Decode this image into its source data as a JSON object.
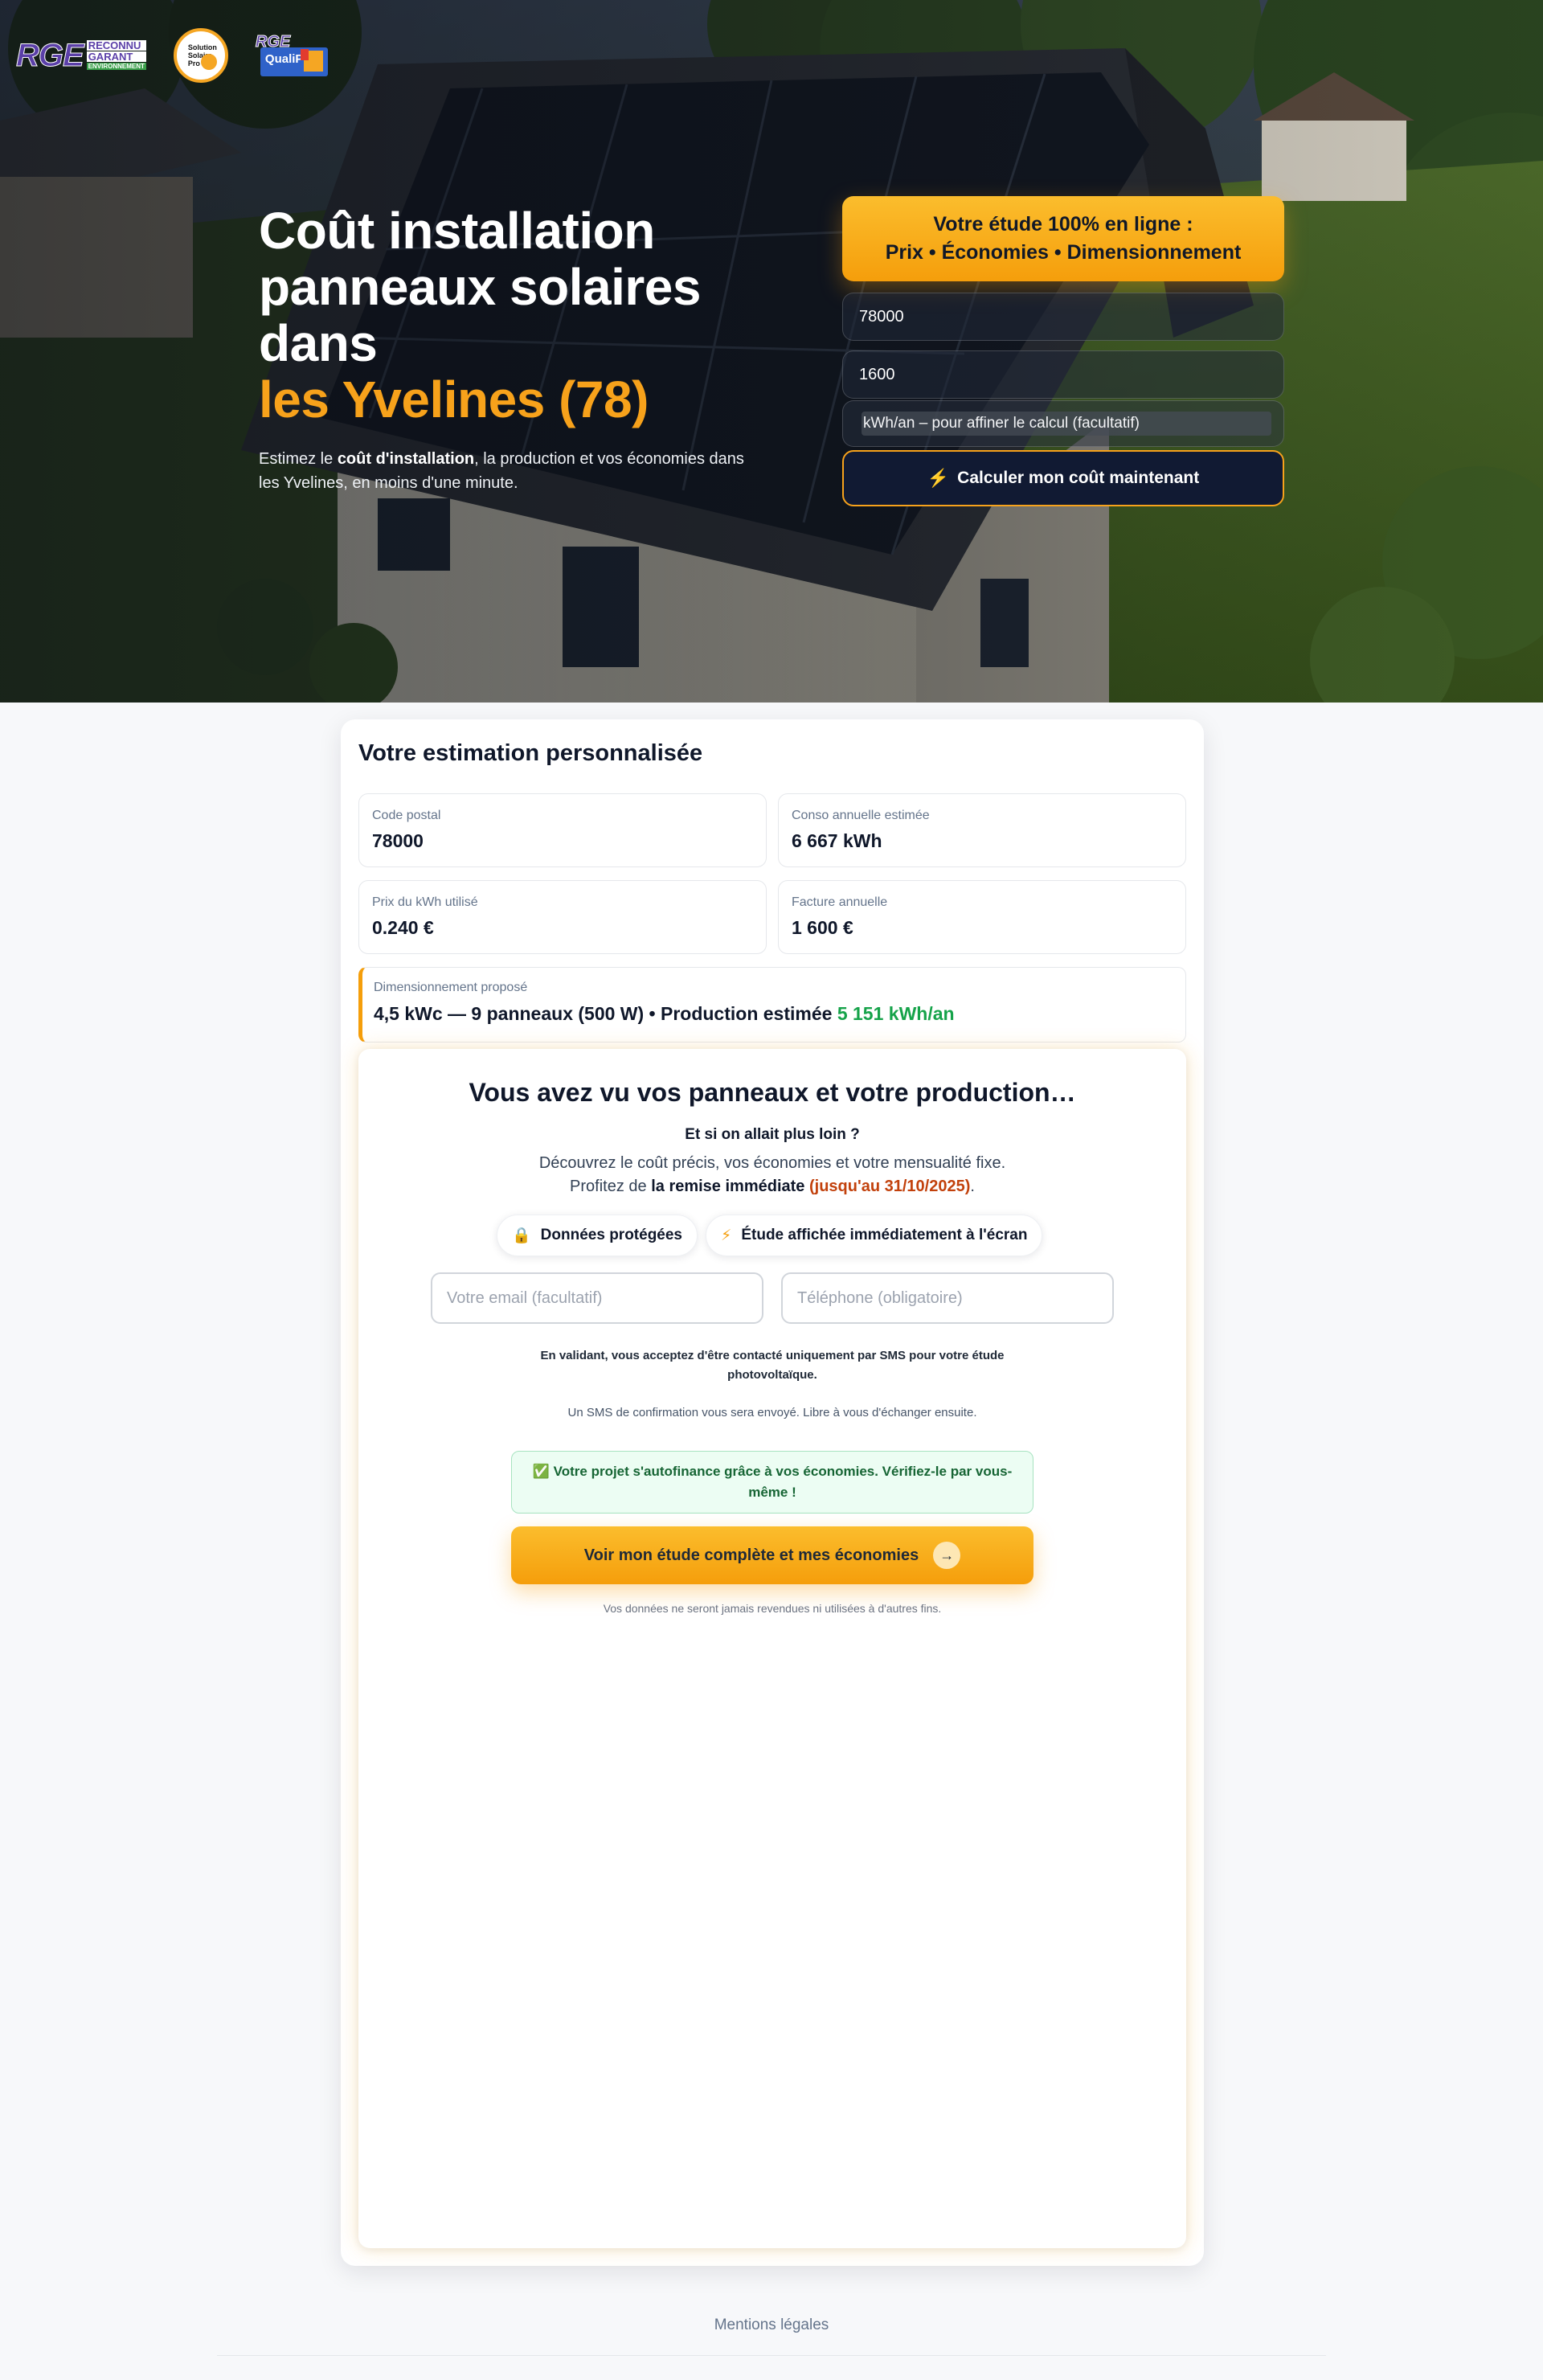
{
  "hero": {
    "title_line1": "Coût installation",
    "title_line2": "panneaux solaires",
    "title_line3": "dans",
    "title_accent": "les Yvelines (78)",
    "subtitle_pre": "Estimez le ",
    "subtitle_bold": "coût d'installation",
    "subtitle_post": ", la production et vos économies dans les Yvelines, en moins d'une minute.",
    "background_image": "house-with-solar-roof-photo"
  },
  "logos": {
    "rge_big": "RGE",
    "rge_line1": "RECONNU",
    "rge_line2": "GARANT",
    "rge_line3": "ENVIRONNEMENT",
    "seal_line1": "Solution",
    "seal_line2": "Solaire",
    "seal_line3": "Pro",
    "qpv_rge": "RGE",
    "qpv_text": "QualiPV"
  },
  "form": {
    "panel_line1": "Votre étude 100% en ligne :",
    "panel_line2": "Prix • Économies • Dimensionnement",
    "postal_value": "78000",
    "bill_value": "1600",
    "kwh_hint": "kWh/an – pour affiner le calcul (facultatif)",
    "submit_icon": "⚡",
    "submit_label": "Calculer mon coût maintenant"
  },
  "estimate": {
    "title": "Votre estimation personnalisée",
    "postal_label": "Code postal",
    "postal_value": "78000",
    "conso_label": "Conso annuelle estimée",
    "conso_value": "6 667 kWh",
    "price_label": "Prix du kWh utilisé",
    "price_value": "0.240 €",
    "bill_label": "Facture annuelle",
    "bill_value": "1 600 €",
    "dim_label": "Dimensionnement proposé",
    "dim_value": "4,5 kWc — 9 panneaux (500 W) • Production estimée ",
    "dim_production": "5 151 kWh/an"
  },
  "lead": {
    "heading": "Vous avez vu vos panneaux et votre production…",
    "question": "Et si on allait plus loin ?",
    "para1": "Découvrez le coût précis, vos économies et votre mensualité fixe.",
    "para2_pre": "Profitez de ",
    "para2_bold": "la remise immédiate",
    "para2_deadline": "(jusqu'au 31/10/2025)",
    "para2_end": ".",
    "chip1_icon": "🔒",
    "chip1_label": "Données protégées",
    "chip2_icon": "⚡",
    "chip2_label": "Étude affichée immédiatement à l'écran",
    "email_placeholder": "Votre email (facultatif)",
    "phone_placeholder": "Téléphone (obligatoire)",
    "consent": "En validant, vous acceptez d'être contacté uniquement par SMS pour votre étude photovoltaïque.",
    "sms_note": "Un SMS de confirmation vous sera envoyé. Libre à vous d'échanger ensuite.",
    "selffund": "✅ Votre projet s'autofinance grâce à vos économies. Vérifiez-le par vous-même !",
    "cta_label": "Voir mon étude complète et mes économies",
    "cta_arrow": "→",
    "privacy": "Vos données ne seront jamais revendues ni utilisées à d'autres fins."
  },
  "footer": {
    "legal": "Mentions légales"
  }
}
